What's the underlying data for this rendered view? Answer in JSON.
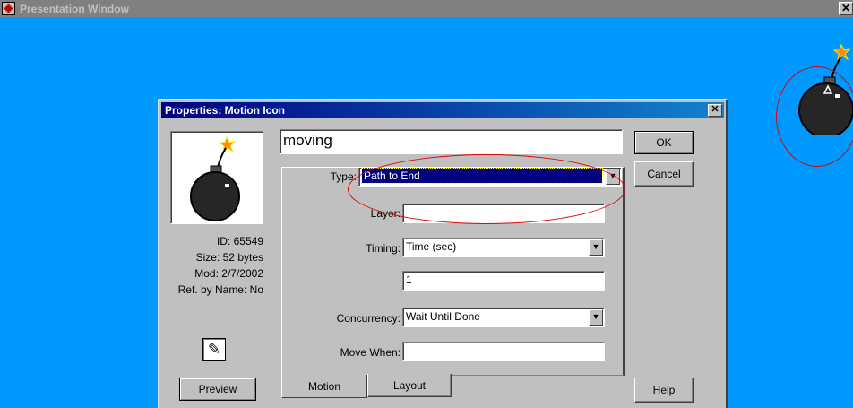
{
  "window": {
    "title": "Presentation Window",
    "close_glyph": "✕"
  },
  "dialog": {
    "title": "Properties: Motion Icon",
    "close_glyph": "✕",
    "icon_name": "moving",
    "info": {
      "id": "ID: 65549",
      "size": "Size: 52 bytes",
      "mod": "Mod: 2/7/2002",
      "ref": "Ref. by Name: No"
    },
    "preview_label": "Preview",
    "type": {
      "label": "Type:",
      "value": "Path to End"
    },
    "layer": {
      "label": "Layer:",
      "value": ""
    },
    "timing": {
      "label": "Timing:",
      "value": "Time (sec)"
    },
    "timing_value": "1",
    "concurrency": {
      "label": "Concurrency:",
      "value": "Wait Until Done"
    },
    "move_when": {
      "label": "Move When:",
      "value": ""
    },
    "tabs": [
      {
        "label": "Motion"
      },
      {
        "label": "Layout"
      }
    ],
    "buttons": {
      "ok": "OK",
      "cancel": "Cancel",
      "help": "Help"
    }
  },
  "colors": {
    "stage_bg": "#0099ff",
    "dialog_bg": "#c0c0c0",
    "selection": "#000080",
    "annotation": "#e00000"
  }
}
